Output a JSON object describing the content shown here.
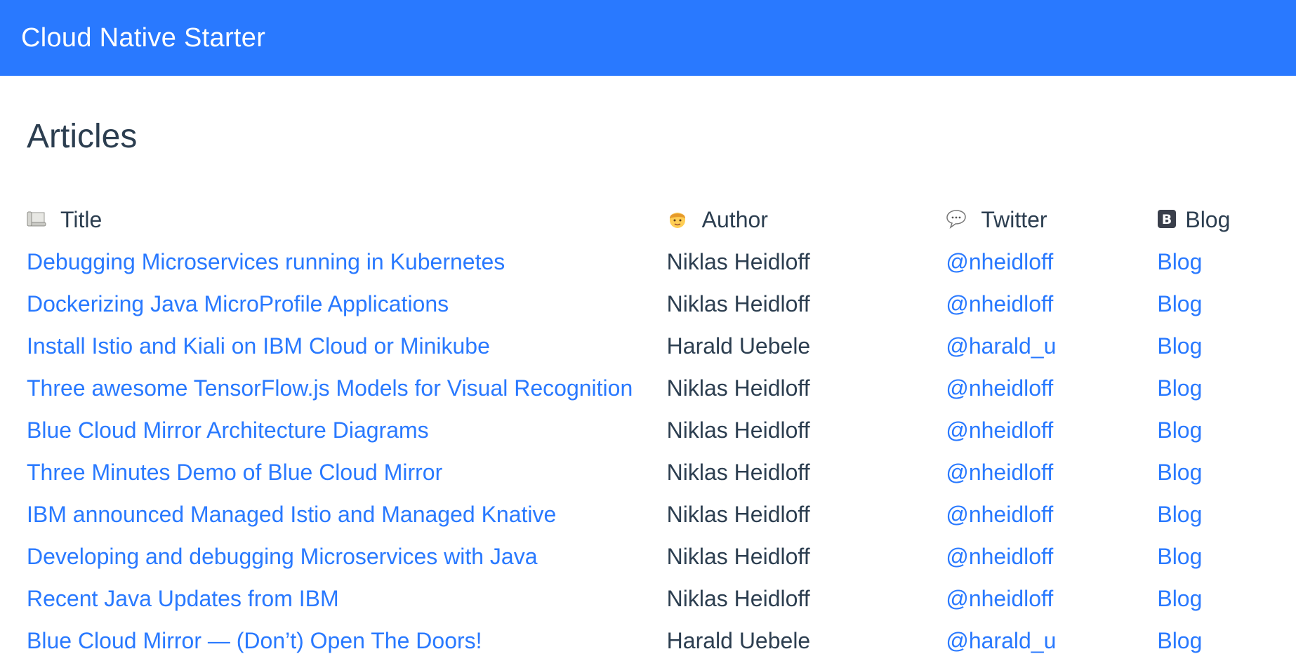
{
  "navbar": {
    "brand": "Cloud Native Starter"
  },
  "page": {
    "title": "Articles"
  },
  "table": {
    "headers": {
      "title": {
        "label": "Title",
        "icon": "scroll-icon"
      },
      "author": {
        "label": "Author",
        "icon": "person-icon"
      },
      "twitter": {
        "label": "Twitter",
        "icon": "speech-bubble-icon"
      },
      "blog": {
        "label": "Blog",
        "icon": "b-letter-icon"
      }
    },
    "rows": [
      {
        "title": "Debugging Microservices running in Kubernetes",
        "author": "Niklas Heidloff",
        "twitter": "@nheidloff",
        "blog": "Blog"
      },
      {
        "title": "Dockerizing Java MicroProfile Applications",
        "author": "Niklas Heidloff",
        "twitter": "@nheidloff",
        "blog": "Blog"
      },
      {
        "title": "Install Istio and Kiali on IBM Cloud or Minikube",
        "author": "Harald Uebele",
        "twitter": "@harald_u",
        "blog": "Blog"
      },
      {
        "title": "Three awesome TensorFlow.js Models for Visual Recognition",
        "author": "Niklas Heidloff",
        "twitter": "@nheidloff",
        "blog": "Blog"
      },
      {
        "title": "Blue Cloud Mirror Architecture Diagrams",
        "author": "Niklas Heidloff",
        "twitter": "@nheidloff",
        "blog": "Blog"
      },
      {
        "title": "Three Minutes Demo of Blue Cloud Mirror",
        "author": "Niklas Heidloff",
        "twitter": "@nheidloff",
        "blog": "Blog"
      },
      {
        "title": "IBM announced Managed Istio and Managed Knative",
        "author": "Niklas Heidloff",
        "twitter": "@nheidloff",
        "blog": "Blog"
      },
      {
        "title": "Developing and debugging Microservices with Java",
        "author": "Niklas Heidloff",
        "twitter": "@nheidloff",
        "blog": "Blog"
      },
      {
        "title": "Recent Java Updates from IBM",
        "author": "Niklas Heidloff",
        "twitter": "@nheidloff",
        "blog": "Blog"
      },
      {
        "title": "Blue Cloud Mirror — (Don’t) Open The Doors!",
        "author": "Harald Uebele",
        "twitter": "@harald_u",
        "blog": "Blog"
      }
    ]
  },
  "colors": {
    "navbar": "#2979ff",
    "link": "#2979ff",
    "text": "#2c3e50"
  }
}
